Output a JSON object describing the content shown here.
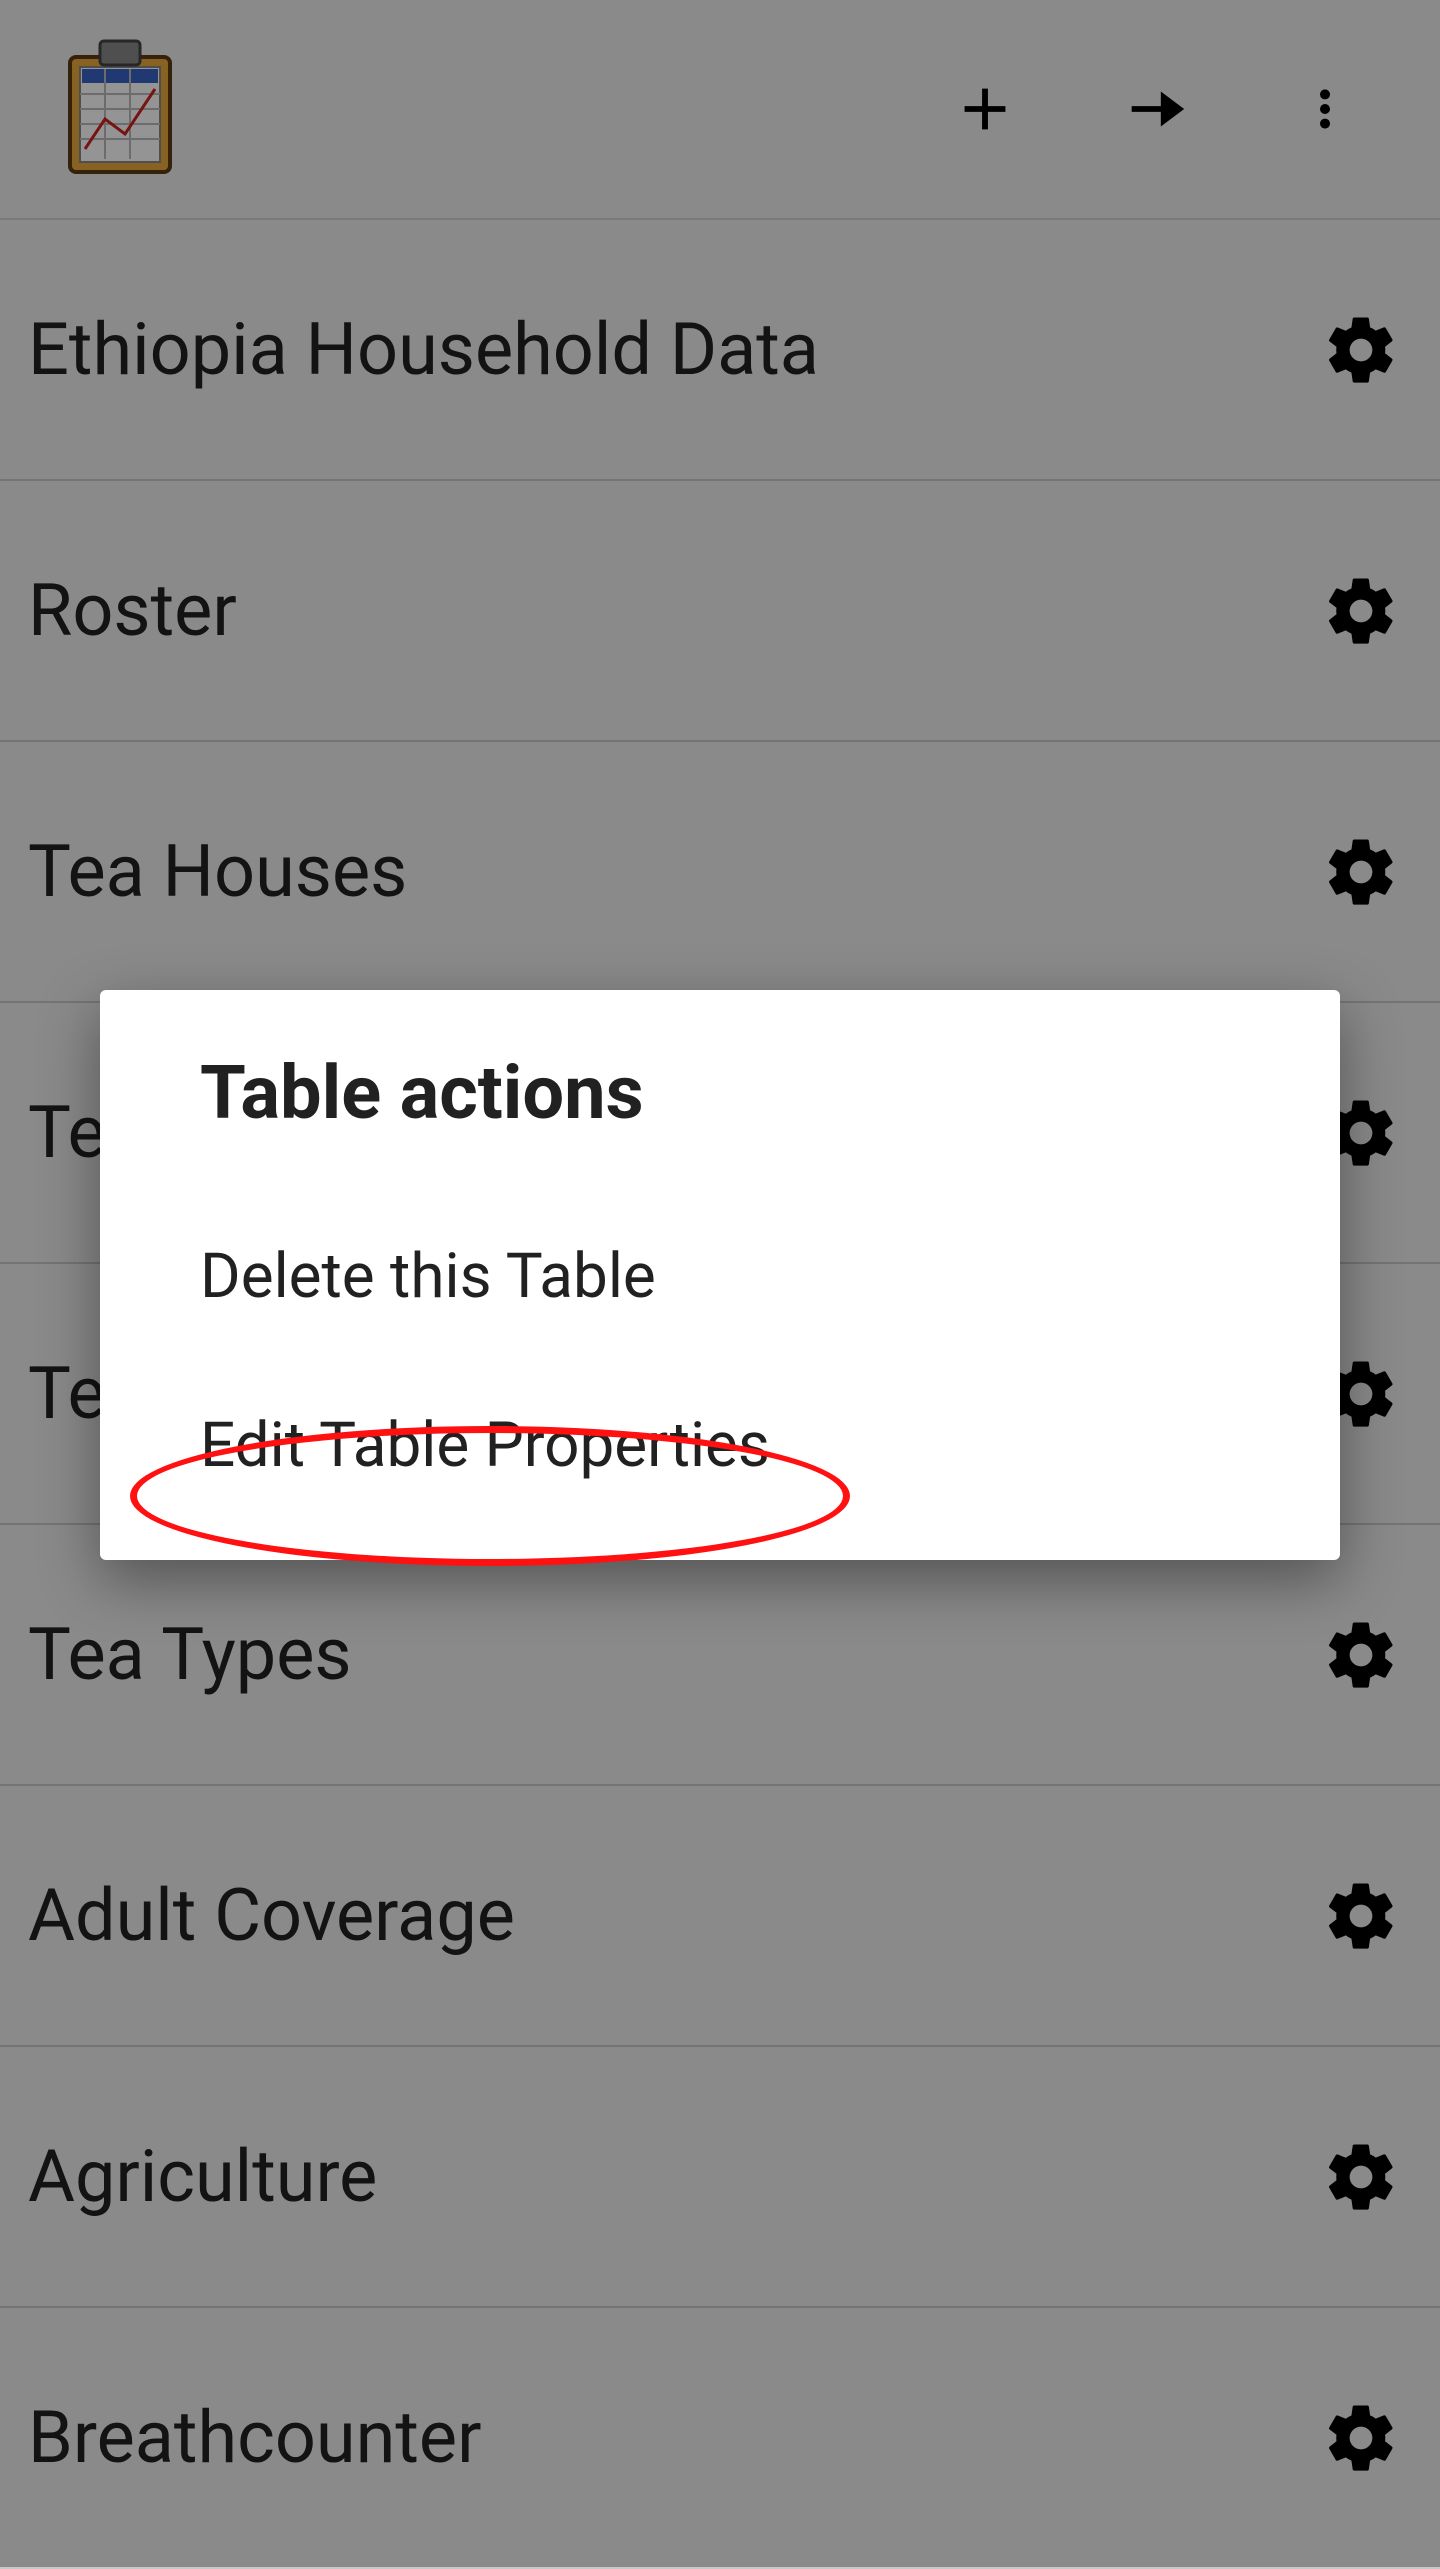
{
  "appbar": {
    "icons": {
      "logo": "clipboard-chart-icon",
      "add": "plus-icon",
      "sync": "arrow-right-icon",
      "overflow": "more-vertical-icon"
    }
  },
  "tables": [
    {
      "label": "Ethiopia Household Data",
      "name_suffix": "ethiopia-household-data"
    },
    {
      "label": "Roster",
      "name_suffix": "roster"
    },
    {
      "label": "Tea Houses",
      "name_suffix": "tea-houses"
    },
    {
      "label": "Tea Houses Editable",
      "name_suffix": "tea-houses-editable"
    },
    {
      "label": "Tea Inventory",
      "name_suffix": "tea-inventory"
    },
    {
      "label": "Tea Types",
      "name_suffix": "tea-types"
    },
    {
      "label": "Adult Coverage",
      "name_suffix": "adult-coverage"
    },
    {
      "label": "Agriculture",
      "name_suffix": "agriculture"
    },
    {
      "label": "Breathcounter",
      "name_suffix": "breathcounter"
    }
  ],
  "dialog": {
    "title": "Table actions",
    "option_delete": "Delete this Table",
    "option_edit": "Edit Table Properties"
  },
  "colors": {
    "accent": "#ff1111"
  }
}
